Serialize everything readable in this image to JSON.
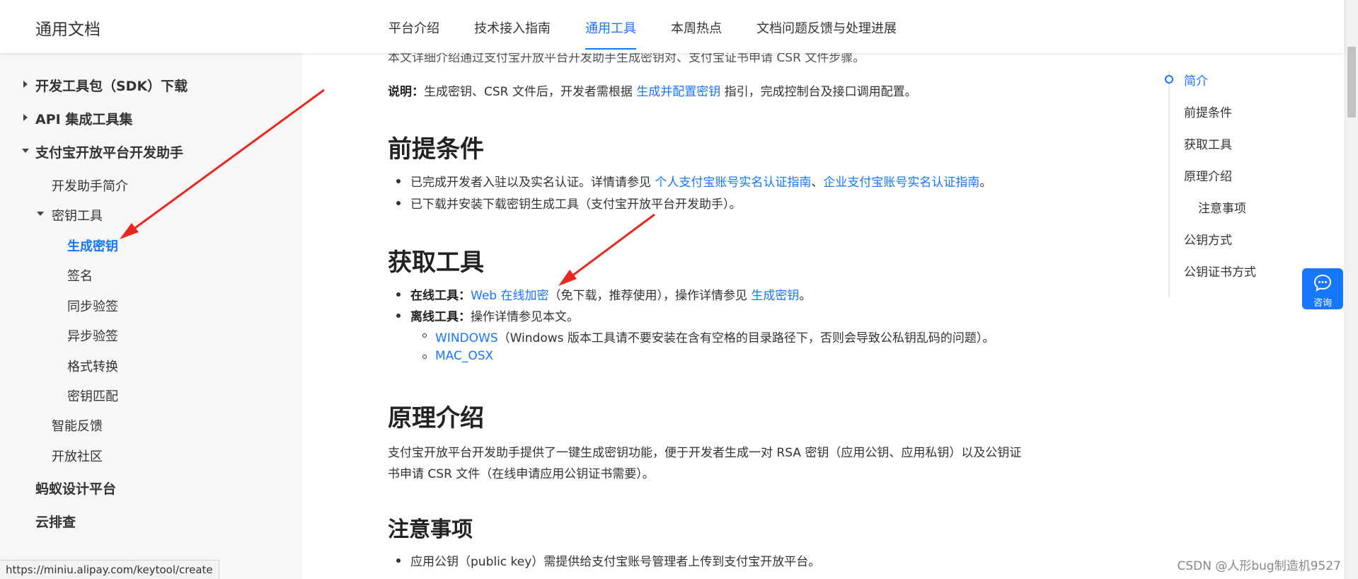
{
  "header": {
    "brand": "通用文档",
    "tabs": [
      {
        "label": "平台介绍"
      },
      {
        "label": "技术接入指南"
      },
      {
        "label": "通用工具",
        "active": true
      },
      {
        "label": "本周热点"
      },
      {
        "label": "文档问题反馈与处理进展"
      }
    ]
  },
  "sidebar": {
    "items": [
      {
        "label": "开发工具包（SDK）下载",
        "level": 1,
        "caret": "right"
      },
      {
        "label": "API 集成工具集",
        "level": 1,
        "caret": "right"
      },
      {
        "label": "支付宝开放平台开发助手",
        "level": 1,
        "caret": "down"
      },
      {
        "label": "开发助手简介",
        "level": 2
      },
      {
        "label": "密钥工具",
        "level": 2,
        "caret": "down"
      },
      {
        "label": "生成密钥",
        "level": 3,
        "active": true
      },
      {
        "label": "签名",
        "level": 3
      },
      {
        "label": "同步验签",
        "level": 3
      },
      {
        "label": "异步验签",
        "level": 3
      },
      {
        "label": "格式转换",
        "level": 3
      },
      {
        "label": "密钥匹配",
        "level": 3
      },
      {
        "label": "智能反馈",
        "level": 2
      },
      {
        "label": "开放社区",
        "level": 2
      },
      {
        "label": "蚂蚁设计平台",
        "level": 1
      },
      {
        "label": "云排查",
        "level": 1
      }
    ]
  },
  "content": {
    "intro_cut": "本文详细介绍通过支付宝开放平台开发助手生成密钥对、支付宝证书申请 CSR 文件步骤。",
    "note_label": "说明：",
    "note_text1": "生成密钥、CSR 文件后，开发者需根据 ",
    "note_link": "生成并配置密钥",
    "note_text2": " 指引，完成控制台及接口调用配置。",
    "sec1_title": "前提条件",
    "sec1_b1_text": "已完成开发者入驻以及实名认证。详情请参见 ",
    "sec1_b1_link1": "个人支付宝账号实名认证指南",
    "sec1_b1_sep": "、",
    "sec1_b1_link2": "企业支付宝账号实名认证指南",
    "sec1_b1_end": "。",
    "sec1_b2": "已下载并安装下载密钥生成工具（支付宝开放平台开发助手）。",
    "sec2_title": "获取工具",
    "online_label": "在线工具：",
    "online_link": "Web 在线加密",
    "online_text": "（免下载，推荐使用），操作详情参见 ",
    "online_link2": "生成密钥",
    "online_end": "。",
    "offline_label": "离线工具：",
    "offline_text": "操作详情参见本文。",
    "win_link": "WINDOWS",
    "win_text": "（Windows 版本工具请不要安装在含有空格的目录路径下，否则会导致公私钥乱码的问题）。",
    "mac_link": "MAC_OSX",
    "sec3_title": "原理介绍",
    "sec3_line1": "支付宝开放平台开发助手提供了一键生成密钥功能，便于开发者生成一对 RSA 密钥（应用公钥、应用私钥）以及公钥证",
    "sec3_line2": "书申请 CSR 文件（在线申请应用公钥证书需要）。",
    "sec4_title": "注意事项",
    "sec4_b1": "应用公钥（public key）需提供给支付宝账号管理者上传到支付宝开放平台。"
  },
  "toc": {
    "items": [
      {
        "label": "简介",
        "active": true
      },
      {
        "label": "前提条件"
      },
      {
        "label": "获取工具"
      },
      {
        "label": "原理介绍"
      },
      {
        "label": "注意事项",
        "sub": true
      },
      {
        "label": "公钥方式"
      },
      {
        "label": "公钥证书方式"
      }
    ]
  },
  "consult": {
    "label": "咨询",
    "icon": "chat-bubble-icon"
  },
  "status_url": "https://miniu.alipay.com/keytool/create",
  "watermark": "CSDN @人形bug制造机9527",
  "colors": {
    "accent": "#1677ff",
    "annotation": "#e8281e"
  }
}
